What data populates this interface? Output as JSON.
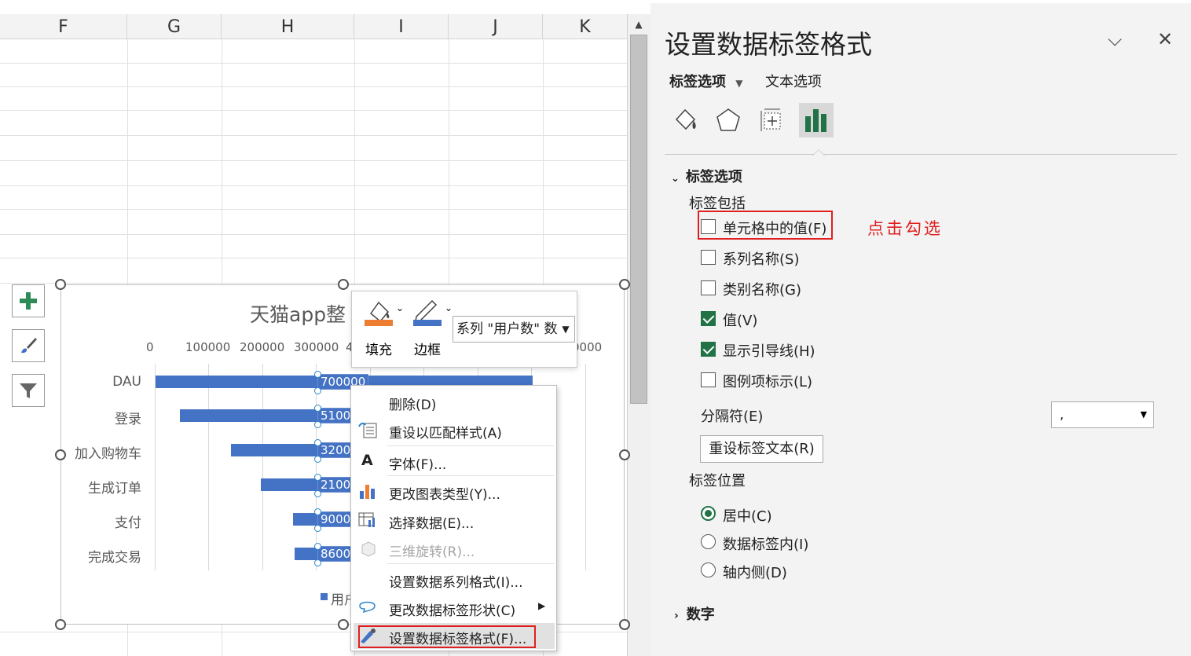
{
  "sheet": {
    "columns": [
      "F",
      "G",
      "H",
      "I",
      "J",
      "K"
    ]
  },
  "chart": {
    "title_visible": "天猫app整",
    "chart_data": {
      "type": "bar",
      "orientation": "horizontal",
      "categories": [
        "DAU",
        "登录",
        "加入购物车",
        "生成订单",
        "支付",
        "完成交易"
      ],
      "x_ticks": [
        "0",
        "100000",
        "200000",
        "300000",
        "4",
        "0000"
      ],
      "series": [
        {
          "name": "用户",
          "values": [
            700000,
            510000,
            320000,
            210000,
            90000,
            86000
          ]
        }
      ],
      "data_labels": [
        "700000",
        "5100",
        "3200",
        "2100",
        "9000",
        "8600"
      ],
      "legend_text": "用户",
      "legend_position": "bottom",
      "colors": {
        "bar": "#4472c4"
      }
    }
  },
  "mini_toolbar": {
    "fill_label": "填充",
    "border_label": "边框",
    "series_select": "系列 \"用户数\" 数"
  },
  "context_menu": {
    "items": [
      {
        "label": "删除(D)",
        "icon": "none"
      },
      {
        "label": "重设以匹配样式(A)",
        "icon": "reset-style-icon"
      },
      {
        "label": "字体(F)...",
        "icon": "font-icon"
      },
      {
        "label": "更改图表类型(Y)...",
        "icon": "chart-type-icon"
      },
      {
        "label": "选择数据(E)...",
        "icon": "select-data-icon"
      },
      {
        "label": "三维旋转(R)...",
        "icon": "3d-rotate-icon",
        "disabled": true
      },
      {
        "label": "设置数据系列格式(I)...",
        "icon": "none"
      },
      {
        "label": "更改数据标签形状(C)",
        "icon": "label-shape-icon",
        "submenu": true
      },
      {
        "label": "设置数据标签格式(F)...",
        "icon": "format-label-icon",
        "highlighted": true
      }
    ]
  },
  "pane": {
    "title": "设置数据标签格式",
    "tab_label_options": "标签选项",
    "tab_text_options": "文本选项",
    "section_label_options": "标签选项",
    "label_contains": "标签包括",
    "checkboxes": [
      {
        "label": "单元格中的值(F)",
        "checked": false
      },
      {
        "label": "系列名称(S)",
        "checked": false
      },
      {
        "label": "类别名称(G)",
        "checked": false
      },
      {
        "label": "值(V)",
        "checked": true
      },
      {
        "label": "显示引导线(H)",
        "checked": true
      },
      {
        "label": "图例项标示(L)",
        "checked": false
      }
    ],
    "separator_label": "分隔符(E)",
    "separator_value": ",",
    "reset_button": "重设标签文本(R)",
    "label_position": "标签位置",
    "radios": [
      {
        "label": "居中(C)",
        "selected": true
      },
      {
        "label": "数据标签内(I)",
        "selected": false
      },
      {
        "label": "轴内侧(D)",
        "selected": false
      }
    ],
    "number_section": "数字",
    "annotation": "点击勾选"
  },
  "colors": {
    "accent_green": "#217346",
    "annotation_red": "#e02020",
    "bar_blue": "#4472c4"
  }
}
